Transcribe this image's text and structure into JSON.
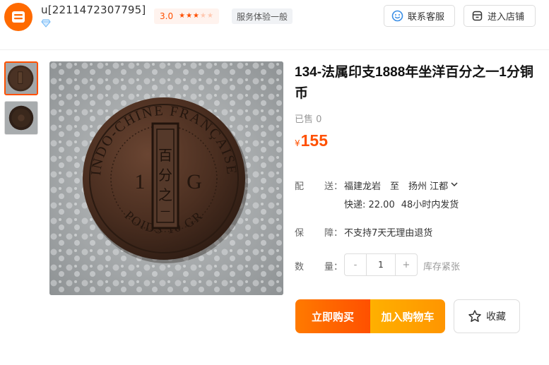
{
  "shop": {
    "name": "u[2211472307795]",
    "rating": "3.0",
    "stars_filled": 3,
    "stars_total": 5,
    "service_tag": "服务体验一般",
    "contact_label": "联系客服",
    "store_label": "进入店铺"
  },
  "product": {
    "title": "134-法属印支1888年坐洋百分之一1分铜币",
    "sold": "已售 0",
    "currency": "¥",
    "price": "155"
  },
  "shipping": {
    "label_a": "配",
    "label_b": "送：",
    "from": "福建龙岩",
    "to_word": "至",
    "to_place": "扬州 江都",
    "fee": "快递: 22.00",
    "dispatch": "48小时内发货"
  },
  "guarantee": {
    "label_a": "保",
    "label_b": "障：",
    "text": "不支持7天无理由退货"
  },
  "quantity": {
    "label_a": "数",
    "label_b": "量：",
    "minus": "-",
    "value": "1",
    "plus": "+",
    "stock": "库存紧张"
  },
  "actions": {
    "buy_now": "立即购买",
    "add_cart": "加入购物车",
    "favorite": "收藏"
  },
  "coin_image": {
    "ring_text_top": "INDO-CHINE FRANÇAISE",
    "ring_text_bottom": "POIDS 10 GR",
    "left_mark": "1",
    "right_mark": "G",
    "center_chars": "百分之一"
  },
  "colors": {
    "accent": "#ff5000",
    "shop_logo": "#ff6a00"
  }
}
